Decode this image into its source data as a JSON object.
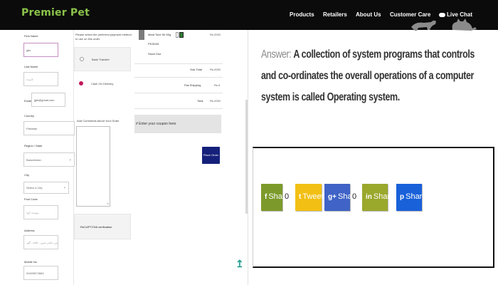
{
  "header": {
    "logo": "Premier Pet",
    "nav": [
      "Products",
      "Retailers",
      "About Us",
      "Customer Care"
    ],
    "live_chat": "Live Chat"
  },
  "form": {
    "first_name": {
      "label": "First Name",
      "value": "jgfs"
    },
    "last_name": {
      "label": "Last Name",
      "placeholder": "لاسٹ"
    },
    "email": {
      "label": "Email",
      "value": "jgfs@gmail.com"
    },
    "country": {
      "label": "Country",
      "value": "Pakistan"
    },
    "region": {
      "label": "Region / State",
      "value": "Balochistan"
    },
    "city": {
      "label": "City",
      "value": "Select a City"
    },
    "post_code": {
      "label": "Post Code",
      "placeholder": "پوسٹ کوڈ"
    },
    "address": {
      "label": "Address",
      "placeholder": "ایڈریس بتائیں شہر، علاقہ، گھر"
    },
    "mobile": {
      "label": "Mobile No",
      "value": "03409874563"
    }
  },
  "payment": {
    "heading": "Please select the preferred payment method to use on this order.",
    "options": [
      {
        "label": "Bank Transfer",
        "selected": false
      },
      {
        "label": "Cash On Delivery",
        "selected": true
      }
    ],
    "comments_label": "Add Comments About Your Order",
    "captcha_text": "ReCAPTCHA verification"
  },
  "cart": {
    "product_name": "Meat Tone Kit 50g",
    "product_code": "PK30/45",
    "product_status": "Stock Due",
    "product_price": "Rs.2000",
    "rows": [
      {
        "label": "Sub-Total",
        "value": "Rs.2000"
      },
      {
        "label": "Flat Shipping",
        "value": "Rs.0"
      },
      {
        "label": "Total",
        "value": "Rs.2000"
      }
    ],
    "coupon_placeholder": "Enter your coupon here",
    "place_order": "Place Order"
  },
  "article": {
    "lead": "Answer:",
    "body": "A collection of system programs that controls and co-ordinates the overall operations of a computer system is called Operating system."
  },
  "share": {
    "buttons": [
      {
        "icon": "f",
        "label": "Share",
        "count": "0",
        "color": "#7c9a2b"
      },
      {
        "icon": "t",
        "label": "Tweet",
        "count": "",
        "color": "#f2c014"
      },
      {
        "icon": "g+",
        "label": "Share",
        "count": "0",
        "color": "#3f63c6"
      },
      {
        "icon": "in",
        "label": "Share",
        "count": "",
        "color": "#9aa82c"
      },
      {
        "icon": "p",
        "label": "Share",
        "count": "",
        "color": "#1961d9"
      }
    ]
  },
  "colors": {
    "brand_green": "#8bc34a",
    "topbar": "#0b0b0b",
    "place_order": "#15207a"
  }
}
